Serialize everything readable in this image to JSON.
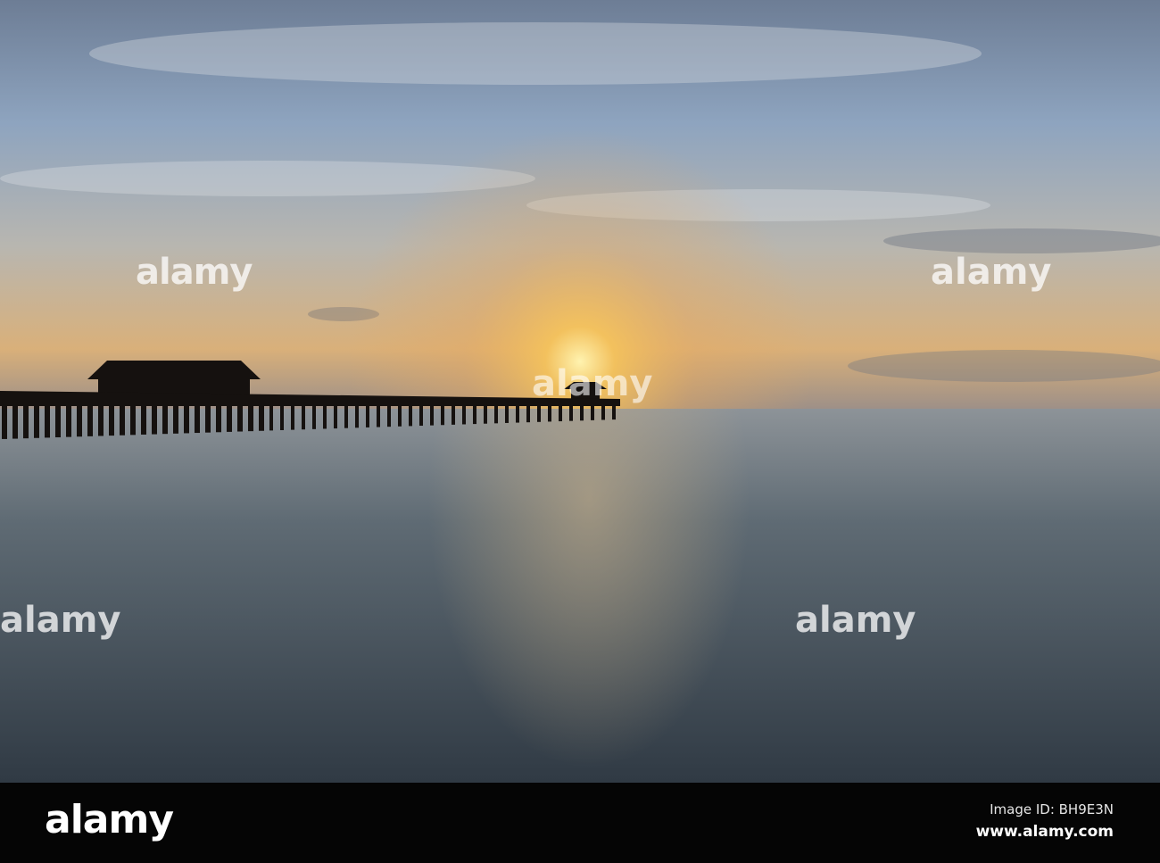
{
  "scene": "sunset over sea with pier silhouette",
  "watermark": {
    "text": "alamy"
  },
  "footer": {
    "logo": "alamy",
    "image_id": "Image ID: BH9E3N",
    "url": "www.alamy.com"
  }
}
